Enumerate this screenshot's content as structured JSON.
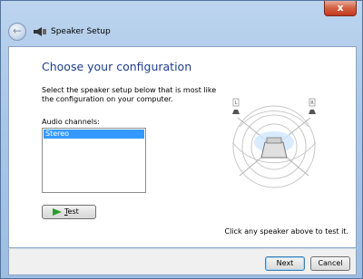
{
  "window": {
    "title": "Speaker Setup",
    "close_label": "x"
  },
  "main": {
    "heading": "Choose your configuration",
    "description": "Select the speaker setup below that is most like the configuration on your computer.",
    "channels_label": "Audio channels:",
    "channels_options": [
      "Stereo"
    ],
    "selected_channel": "Stereo",
    "test_button_label_prefix": "",
    "test_button_label_underlined": "T",
    "test_button_label_rest": "est",
    "hint": "Click any speaker above to test it.",
    "speaker_labels": [
      "L",
      "R"
    ]
  },
  "footer": {
    "next_label": "Next",
    "cancel_label": "Cancel"
  },
  "colors": {
    "heading": "#1e3e8a",
    "selection": "#3399ff",
    "play_icon": "#2a9d2a"
  },
  "icons": {
    "back": "back-arrow-icon",
    "speaker": "speaker-icon",
    "play": "play-icon"
  }
}
